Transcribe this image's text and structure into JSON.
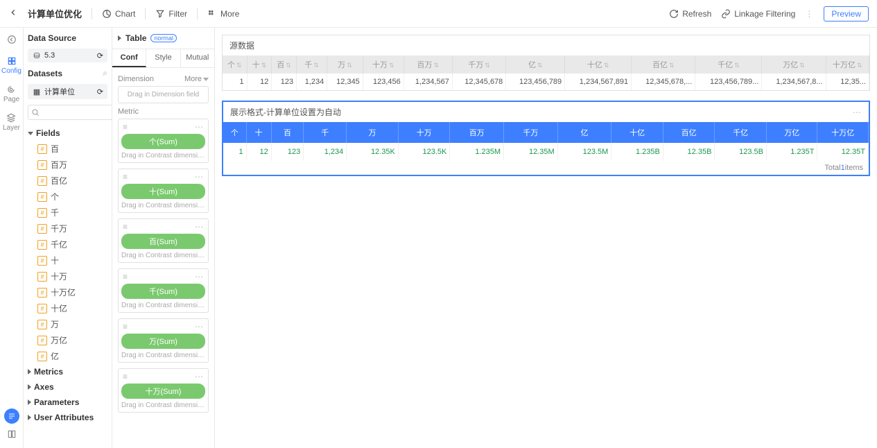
{
  "topbar": {
    "title": "计算单位优化",
    "chart": "Chart",
    "filter": "Filter",
    "more": "More",
    "refresh": "Refresh",
    "linkage": "Linkage Filtering",
    "preview": "Preview"
  },
  "rail": {
    "config": "Config",
    "page": "Page",
    "layer": "Layer"
  },
  "panel1": {
    "data_source": "Data Source",
    "source_name": "5.3",
    "datasets": "Datasets",
    "dataset_name": "计算单位",
    "fields_label": "Fields",
    "fields": [
      "百",
      "百万",
      "百亿",
      "个",
      "千",
      "千万",
      "千亿",
      "十",
      "十万",
      "十万亿",
      "十亿",
      "万",
      "万亿",
      "亿"
    ],
    "metrics": "Metrics",
    "axes": "Axes",
    "parameters": "Parameters",
    "user_attrs": "User Attributes"
  },
  "panel2": {
    "table": "Table",
    "tag": "normal",
    "tabs": [
      "Conf",
      "Style",
      "Mutual"
    ],
    "dimension": "Dimension",
    "more": "More",
    "drag_dim": "Drag in Dimension field",
    "metric": "Metric",
    "contrast_hint": "Drag in Contrast dimension fi...",
    "metrics": [
      {
        "label": "个(Sum)"
      },
      {
        "label": "十(Sum)"
      },
      {
        "label": "百(Sum)"
      },
      {
        "label": "千(Sum)"
      },
      {
        "label": "万(Sum)"
      },
      {
        "label": "十万(Sum)"
      }
    ]
  },
  "canvas": {
    "card1": {
      "title": "源数据",
      "headers": [
        "个",
        "十",
        "百",
        "千",
        "万",
        "十万",
        "百万",
        "千万",
        "亿",
        "十亿",
        "百亿",
        "千亿",
        "万亿",
        "十万亿"
      ],
      "row": [
        "1",
        "12",
        "123",
        "1,234",
        "12,345",
        "123,456",
        "1,234,567",
        "12,345,678",
        "123,456,789",
        "1,234,567,891",
        "12,345,678,...",
        "123,456,789...",
        "1,234,567,8...",
        "12,35..."
      ]
    },
    "card2": {
      "title": "展示格式-计算单位设置为自动",
      "headers": [
        "个",
        "十",
        "百",
        "千",
        "万",
        "十万",
        "百万",
        "千万",
        "亿",
        "十亿",
        "百亿",
        "千亿",
        "万亿",
        "十万亿"
      ],
      "row": [
        "1",
        "12",
        "123",
        "1,234",
        "12.35K",
        "123.5K",
        "1.235M",
        "12.35M",
        "123.5M",
        "1.235B",
        "12.35B",
        "123.5B",
        "1.235T",
        "12.35T"
      ],
      "footer_total": "Total",
      "footer_count": "1",
      "footer_items": "items"
    }
  }
}
